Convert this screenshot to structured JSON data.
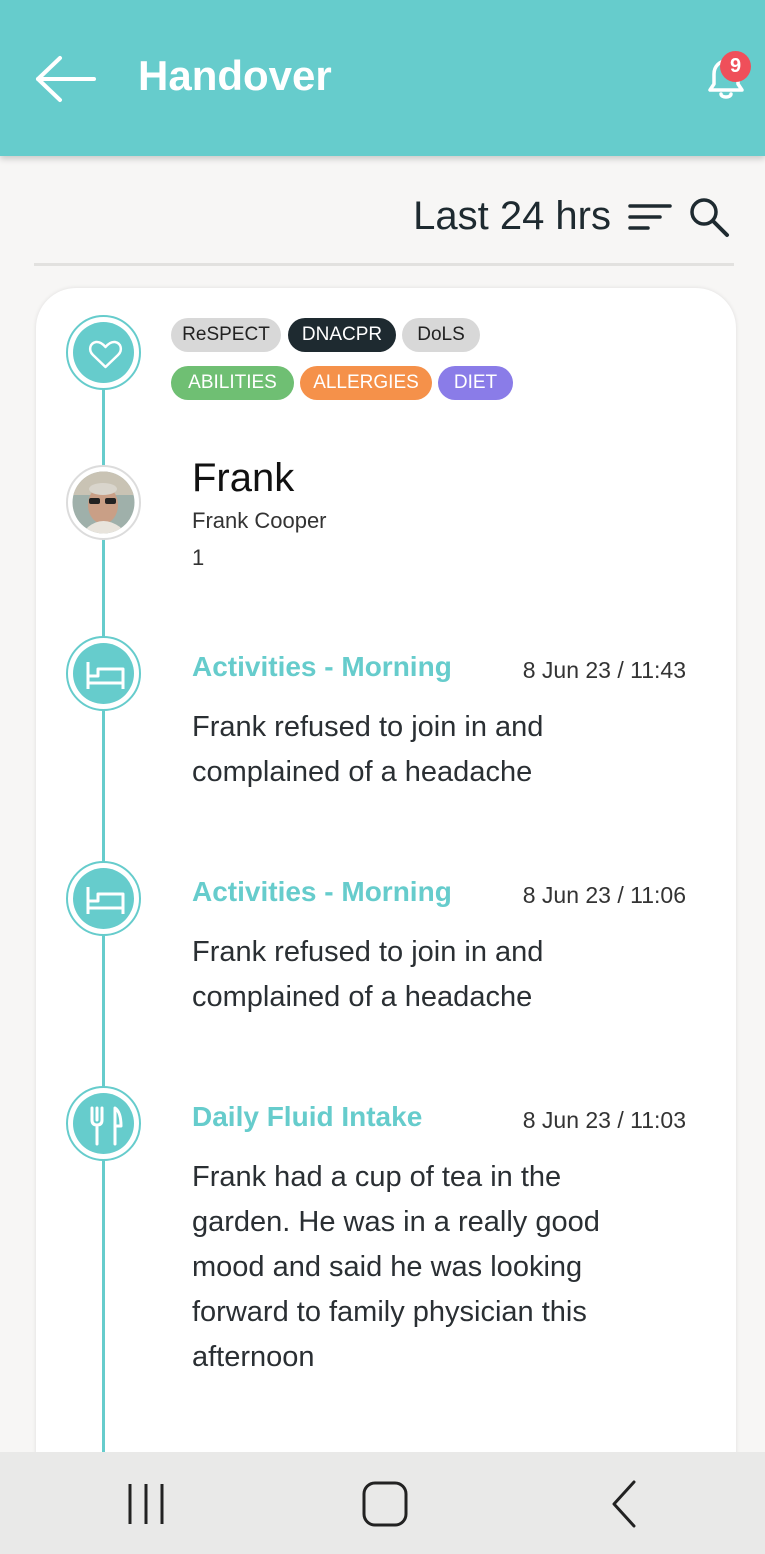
{
  "header": {
    "title": "Handover",
    "notification_count": "9"
  },
  "filter": {
    "period_label": "Last 24 hrs"
  },
  "tags": {
    "row1": [
      {
        "label": "ReSPECT",
        "bg": "#d8d8d8",
        "fg": "#222222"
      },
      {
        "label": "DNACPR",
        "bg": "#1e2a30",
        "fg": "#ffffff"
      },
      {
        "label": "DoLS",
        "bg": "#d8d8d8",
        "fg": "#222222"
      }
    ],
    "row2": [
      {
        "label": "ABILITIES",
        "bg": "#6fbf73",
        "fg": "#ffffff"
      },
      {
        "label": "ALLERGIES",
        "bg": "#f5914a",
        "fg": "#ffffff"
      },
      {
        "label": "DIET",
        "bg": "#8a7ce8",
        "fg": "#ffffff"
      }
    ]
  },
  "resident": {
    "preferred_name": "Frank",
    "full_name": "Frank Cooper",
    "room": "1"
  },
  "entries": [
    {
      "title": "Activities - Morning",
      "date": "8 Jun 23 / 11:43",
      "icon": "bed-icon",
      "text": "Frank refused to join in and complained of a headache"
    },
    {
      "title": "Activities - Morning",
      "date": "8 Jun 23 / 11:06",
      "icon": "bed-icon",
      "text": "Frank refused to join in and complained of a headache"
    },
    {
      "title": "Daily Fluid Intake",
      "date": "8 Jun 23 / 11:03",
      "icon": "fork-knife-icon",
      "text": "Frank had a cup of tea in the garden. He was in a really good mood and said he was looking forward to family physician this afternoon"
    }
  ],
  "colors": {
    "accent": "#66cccc",
    "badge": "#ef4f5a"
  }
}
